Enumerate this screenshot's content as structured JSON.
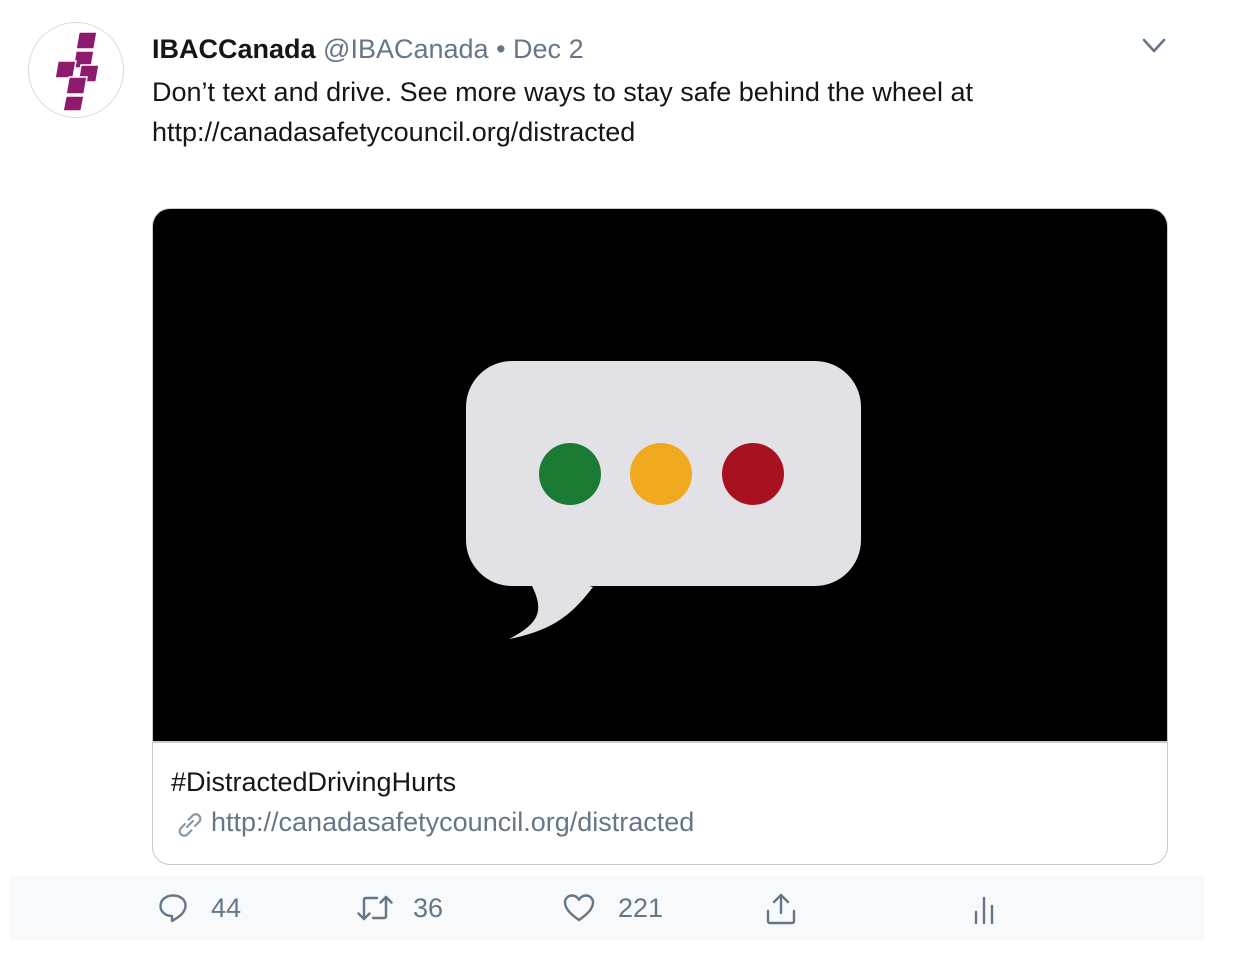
{
  "tweet": {
    "author_name": "IBACCanada",
    "author_handle": "@IBACanada",
    "separator": "•",
    "date": "Dec 2",
    "text_line_1": "Don’t text and drive. See more ways to stay safe behind the wheel at",
    "text_line_2": "http://canadasafetycouncil.org/distracted"
  },
  "card": {
    "title": "#DistractedDrivingHurts",
    "link": "http://canadasafetycouncil.org/distracted",
    "dot_colors": [
      "#1b7a33",
      "#f0a91e",
      "#a8111f"
    ],
    "bubble_color": "#e1e1e6"
  },
  "actions": {
    "replies": "44",
    "retweets": "36",
    "likes": "221"
  },
  "icons": {
    "avatar": "ibac-logo-icon",
    "menu": "chevron-down-icon",
    "link": "link-icon",
    "reply": "reply-icon",
    "retweet": "retweet-icon",
    "like": "heart-icon",
    "share": "share-icon",
    "analytics": "analytics-icon"
  },
  "colors": {
    "brand_logo": "#8e1a6e",
    "secondary_text": "#657786",
    "primary_text": "#14171a"
  }
}
